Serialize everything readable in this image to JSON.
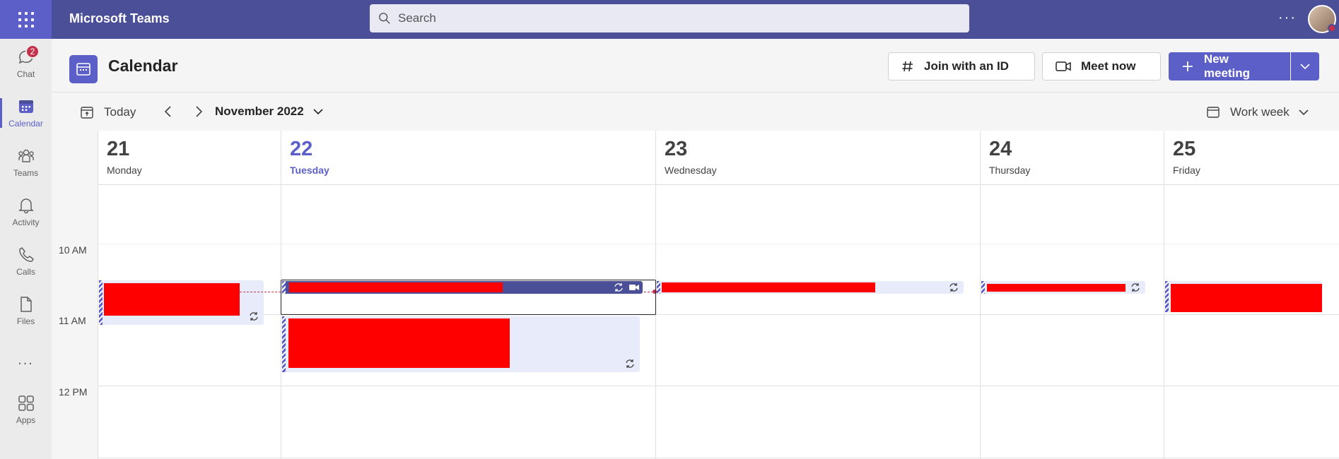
{
  "app": {
    "title": "Microsoft Teams"
  },
  "search": {
    "placeholder": "Search"
  },
  "rail": {
    "items": [
      {
        "label": "Chat",
        "icon": "chat-icon",
        "badge": "2"
      },
      {
        "label": "Calendar",
        "icon": "calendar-icon",
        "active": true
      },
      {
        "label": "Teams",
        "icon": "teams-icon"
      },
      {
        "label": "Activity",
        "icon": "bell-icon"
      },
      {
        "label": "Calls",
        "icon": "phone-icon"
      },
      {
        "label": "Files",
        "icon": "file-icon"
      },
      {
        "label": "...",
        "icon": "more-icon"
      },
      {
        "label": "Apps",
        "icon": "apps-icon"
      }
    ]
  },
  "header": {
    "title": "Calendar",
    "join_label": "Join with an ID",
    "meet_label": "Meet now",
    "new_label": "New meeting"
  },
  "toolbar": {
    "today_label": "Today",
    "month_label": "November 2022",
    "view_label": "Work week"
  },
  "days": [
    {
      "num": "21",
      "name": "Monday"
    },
    {
      "num": "22",
      "name": "Tuesday",
      "today": true
    },
    {
      "num": "23",
      "name": "Wednesday"
    },
    {
      "num": "24",
      "name": "Thursday"
    },
    {
      "num": "25",
      "name": "Friday"
    }
  ],
  "hours": [
    "10 AM",
    "11 AM",
    "12 PM"
  ],
  "colors": {
    "accent": "#5b5fc7",
    "topbar": "#4b4f97",
    "event_bg": "#e8ebfa",
    "now_line": "#c4314b"
  }
}
